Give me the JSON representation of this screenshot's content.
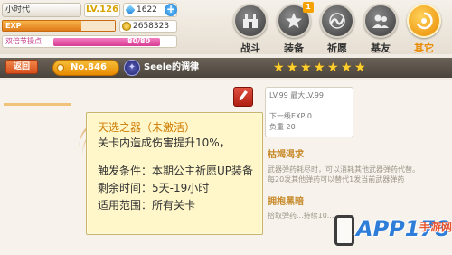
{
  "player": {
    "name": "小时代",
    "level": "LV.126",
    "gems": "1622",
    "exp_label": "EXP",
    "exp_progress": 0.7,
    "gold": "2658323",
    "bonus_label": "双倍节操点",
    "bonus_value": "80/80"
  },
  "nav": [
    {
      "label": "战斗",
      "icon": "battle-icon",
      "badge": ""
    },
    {
      "label": "装备",
      "icon": "equipment-star-icon",
      "badge": "1"
    },
    {
      "label": "祈愿",
      "icon": "wish-icon",
      "badge": ""
    },
    {
      "label": "基友",
      "icon": "friends-icon",
      "badge": ""
    },
    {
      "label": "其它",
      "icon": "other-icon",
      "badge": "",
      "active": true
    }
  ],
  "titlebar": {
    "back_label": "返回",
    "number": "No.846",
    "hero_name": "Seele的调律",
    "stars": 7
  },
  "weapon": {
    "level_line": "LV.99 最大LV.99",
    "next_exp": "下一级EXP 0",
    "load": "负重 20",
    "skill_title": "枯竭渴求",
    "skill_desc": "武器弹药耗尽时，可以消耗其他武器弹药代替。每20发其他弹药可以替代1发当前武器弹药",
    "skill_title2": "拥抱黑暗",
    "skill_desc2": "拾取弹药...持续10..."
  },
  "tooltip": {
    "title": "天选之器（未激活）",
    "effect": "关卡内造成伤害提升10%，",
    "condition": "触发条件：本期公主祈愿UP装备",
    "remaining": "剩余时间：5天-19小时",
    "scope": "适用范围：所有关卡"
  },
  "watermark": {
    "text": "APP178",
    "sub": "手游网"
  }
}
